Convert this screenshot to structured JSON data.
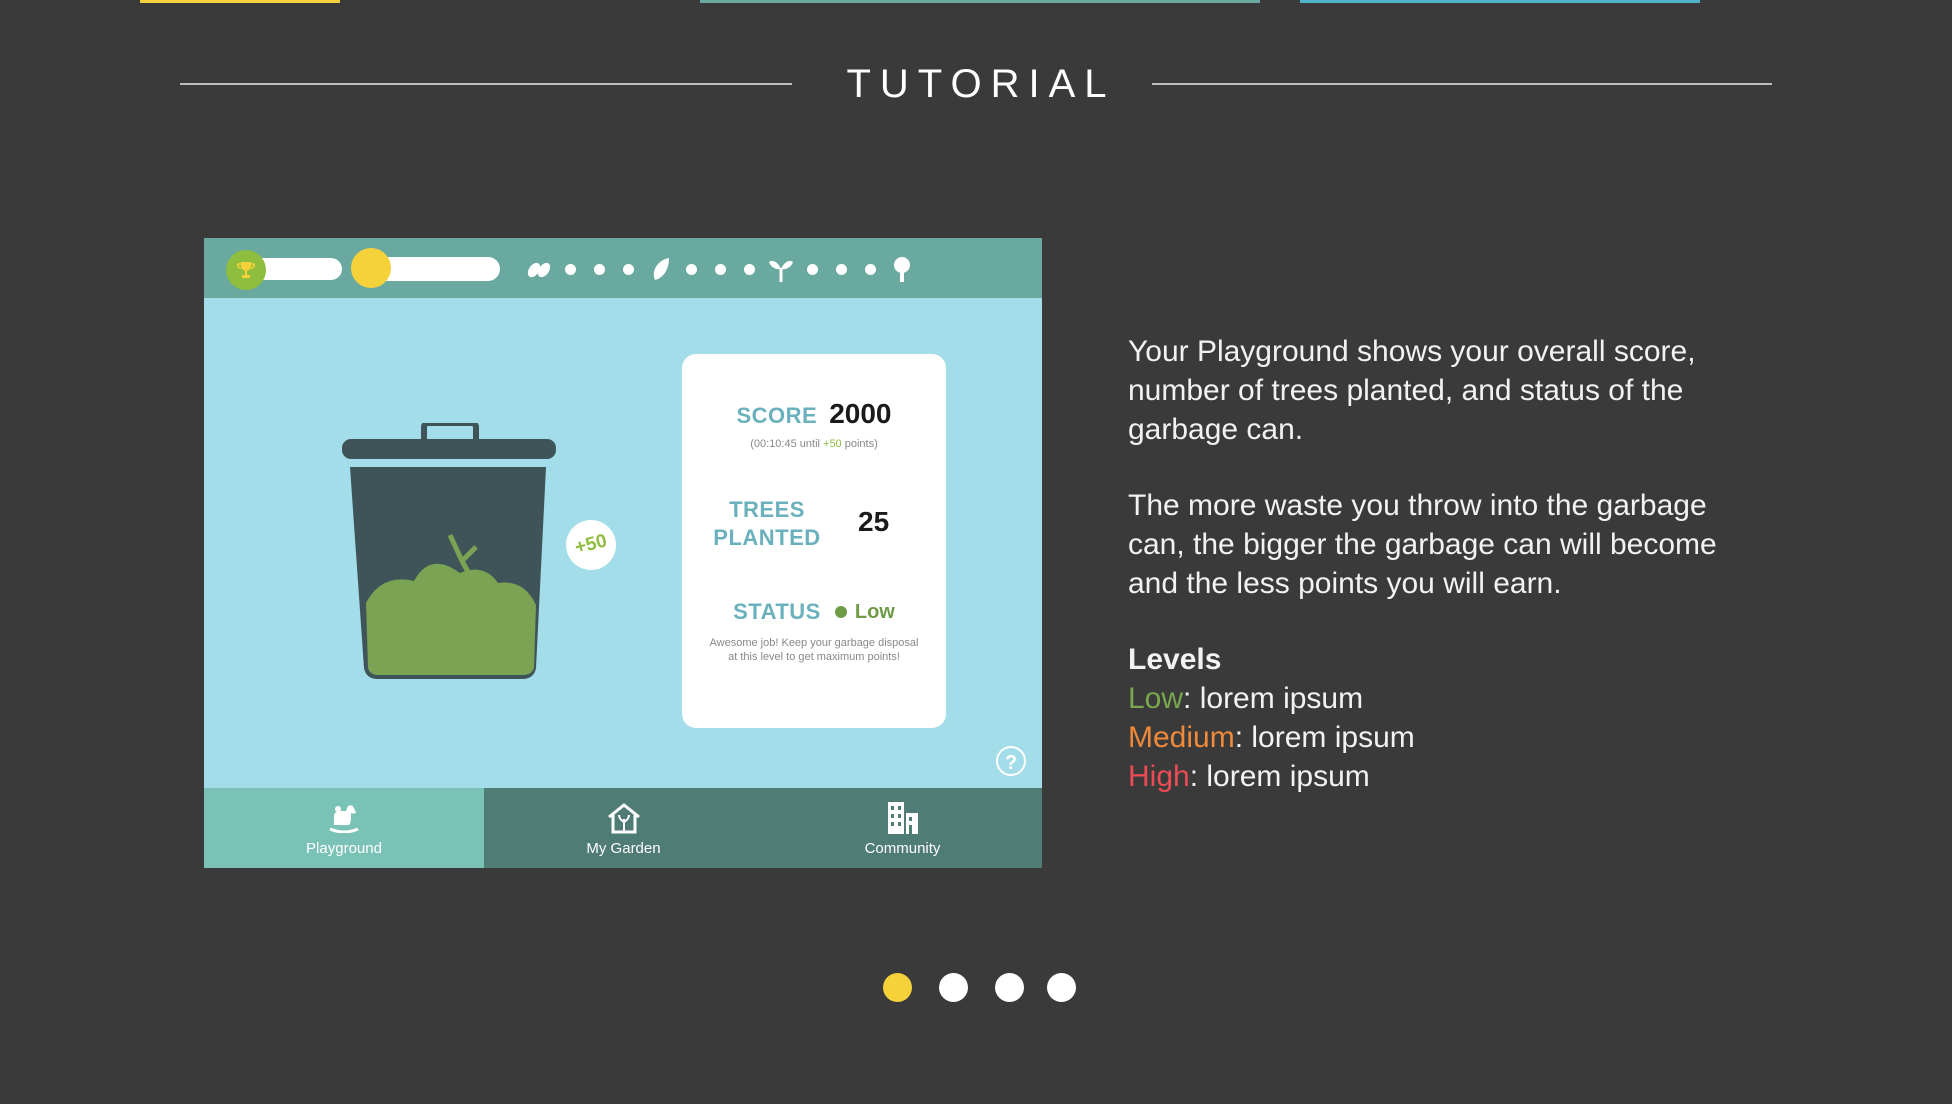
{
  "page": {
    "title": "TUTORIAL",
    "colors": {
      "background": "#3a3a3a",
      "accent_yellow": "#f5d23a",
      "low": "#7aa84e",
      "medium": "#f08a3a",
      "high": "#ec4b55"
    }
  },
  "app": {
    "topbar": {
      "trophy_icon": "trophy-icon",
      "coin_icon": "coin-icon",
      "progress_icons": [
        "seeds-icon",
        "leaf-icon",
        "sprout-icon",
        "tree-icon"
      ]
    },
    "badge": "+50",
    "card": {
      "score_label": "SCORE",
      "score_value": "2000",
      "timer": "(00:10:45 until ",
      "timer_bonus": "+50",
      "timer_suffix": " points)",
      "trees_label_line1": "TREES",
      "trees_label_line2": "PLANTED",
      "trees_value": "25",
      "status_label": "STATUS",
      "status_value": "Low",
      "status_description": "Awesome job! Keep your garbage disposal at this level to get maximum points!"
    },
    "help": "?",
    "nav": [
      {
        "label": "Playground",
        "icon": "rocking-horse-icon",
        "active": true
      },
      {
        "label": "My Garden",
        "icon": "garden-house-icon",
        "active": false
      },
      {
        "label": "Community",
        "icon": "buildings-icon",
        "active": false
      }
    ]
  },
  "description": {
    "paragraph1": "Your Playground shows your overall score, number of trees planted, and status of the garbage can.",
    "paragraph2": "The more waste you throw into the garbage can, the bigger the garbage can will become and the less points you will earn.",
    "levels_heading": "Levels",
    "levels": [
      {
        "name": "Low",
        "text": ": lorem ipsum"
      },
      {
        "name": "Medium",
        "text": ": lorem ipsum"
      },
      {
        "name": "High",
        "text": ": lorem ipsum"
      }
    ]
  },
  "pagination": {
    "total": 4,
    "current": 1
  }
}
